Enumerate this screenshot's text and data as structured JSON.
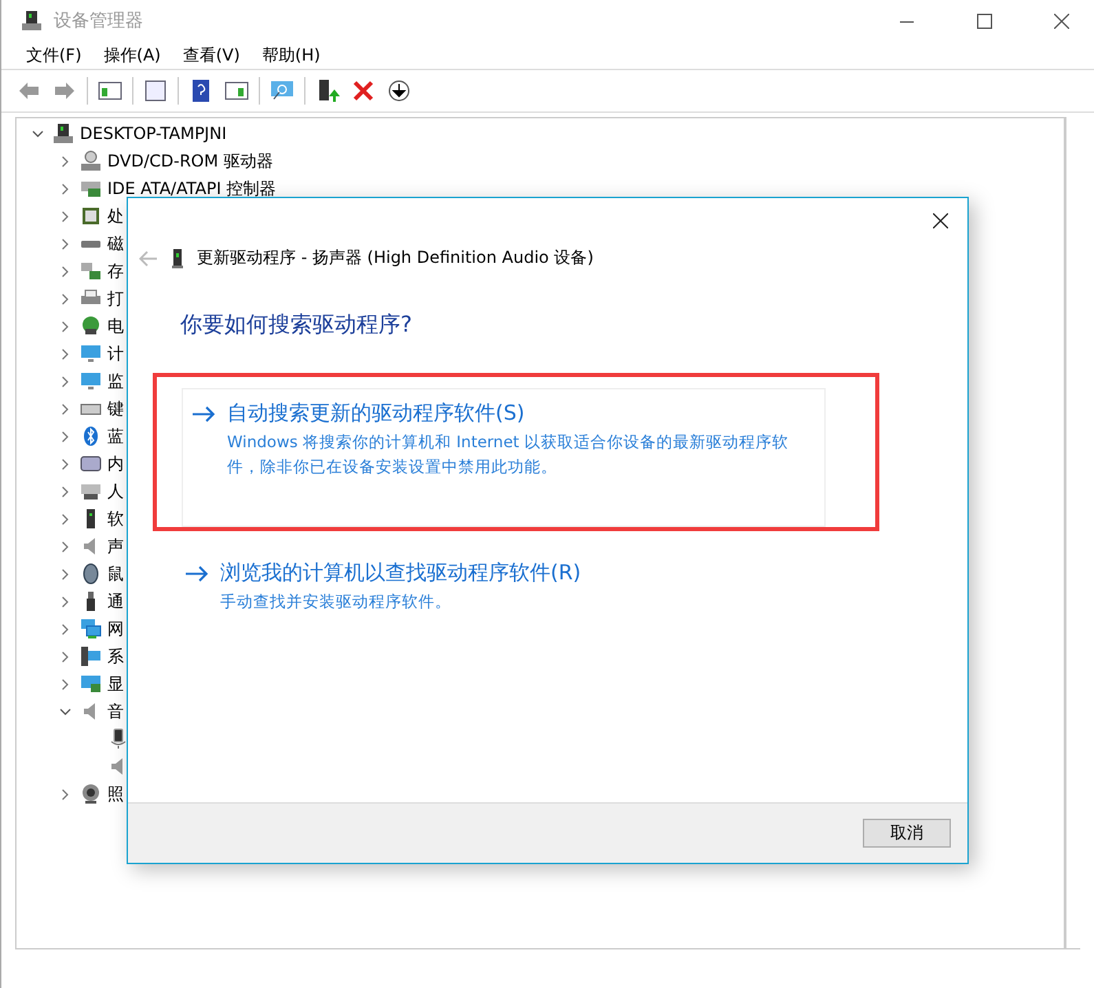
{
  "window": {
    "title": "设备管理器"
  },
  "menu": [
    "文件(F)",
    "操作(A)",
    "查看(V)",
    "帮助(H)"
  ],
  "tree": {
    "root": "DESKTOP-TAMPJNI",
    "expanded": true,
    "items": [
      {
        "label": "DVD/CD-ROM 驱动器",
        "expanded": false
      },
      {
        "label": "IDE ATA/ATAPI 控制器",
        "expanded": false
      },
      {
        "label": "处",
        "expanded": false
      },
      {
        "label": "磁",
        "expanded": false
      },
      {
        "label": "存",
        "expanded": false
      },
      {
        "label": "打",
        "expanded": false
      },
      {
        "label": "电",
        "expanded": false
      },
      {
        "label": "计",
        "expanded": false
      },
      {
        "label": "监",
        "expanded": false
      },
      {
        "label": "键",
        "expanded": false
      },
      {
        "label": "蓝",
        "expanded": false
      },
      {
        "label": "内",
        "expanded": false
      },
      {
        "label": "人",
        "expanded": false
      },
      {
        "label": "软",
        "expanded": false
      },
      {
        "label": "声",
        "expanded": false
      },
      {
        "label": "鼠",
        "expanded": false
      },
      {
        "label": "通",
        "expanded": false
      },
      {
        "label": "网",
        "expanded": false
      },
      {
        "label": "系",
        "expanded": false
      },
      {
        "label": "显",
        "expanded": false
      },
      {
        "label": "音",
        "expanded": true,
        "children": [
          {
            "kind": "microphone"
          },
          {
            "kind": "speaker"
          }
        ]
      },
      {
        "label": "照",
        "expanded": false
      }
    ]
  },
  "dialog": {
    "title": "更新驱动程序 - 扬声器 (High Definition Audio 设备)",
    "heading": "你要如何搜索驱动程序?",
    "options": [
      {
        "title": "自动搜索更新的驱动程序软件(S)",
        "description": "Windows 将搜索你的计算机和 Internet 以获取适合你设备的最新驱动程序软件，除非你已在设备安装设置中禁用此功能。",
        "highlighted": true
      },
      {
        "title": "浏览我的计算机以查找驱动程序软件(R)",
        "description": "手动查找并安装驱动程序软件。",
        "highlighted": false
      }
    ],
    "cancel": "取消"
  }
}
